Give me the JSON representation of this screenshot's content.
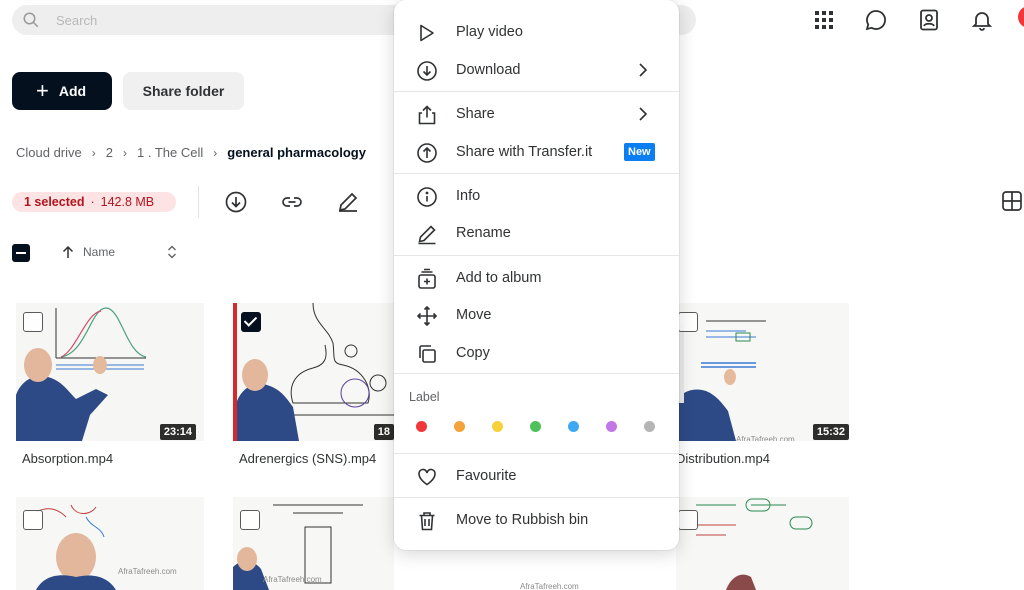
{
  "search": {
    "placeholder": "Search"
  },
  "toolbar": {
    "add_label": "Add",
    "share_folder_label": "Share folder"
  },
  "top_icons": [
    "apps-grid-icon",
    "chat-icon",
    "contacts-icon",
    "bell-icon"
  ],
  "breadcrumb": {
    "items": [
      "Cloud drive",
      "2",
      "1 . The Cell"
    ],
    "current": "general pharmacology"
  },
  "selection": {
    "count_label": "1 selected",
    "separator": "·",
    "size": "142.8 MB"
  },
  "sort": {
    "label": "Name"
  },
  "files": [
    {
      "name": "Absorption.mp4",
      "duration": "23:14",
      "checked": false
    },
    {
      "name": "Adrenergics (SNS).mp4",
      "duration": "18",
      "checked": true
    },
    {
      "name": "Distribution.mp4",
      "duration": "15:32",
      "checked": false
    },
    {
      "name": "",
      "duration": "",
      "checked": false
    },
    {
      "name": "",
      "duration": "",
      "checked": false
    },
    {
      "name": "",
      "duration": "",
      "checked": false
    }
  ],
  "watermark": "AfraTafreeh.com",
  "menu": {
    "play": "Play video",
    "download": "Download",
    "share": "Share",
    "transfer": "Share with Transfer.it",
    "new_badge": "New",
    "info": "Info",
    "rename": "Rename",
    "add_album": "Add to album",
    "move": "Move",
    "copy": "Copy",
    "label_title": "Label",
    "label_colors": [
      "#f0373a",
      "#f2a33a",
      "#f7d13a",
      "#4fc15b",
      "#3ea9f2",
      "#c178e6",
      "#b5b5b5"
    ],
    "favourite": "Favourite",
    "rubbish": "Move to Rubbish bin"
  },
  "colors": {
    "accent": "#04101e",
    "selection_bg": "#fde3e4",
    "selection_text": "#b0161d",
    "new_badge": "#0b7ef1"
  }
}
